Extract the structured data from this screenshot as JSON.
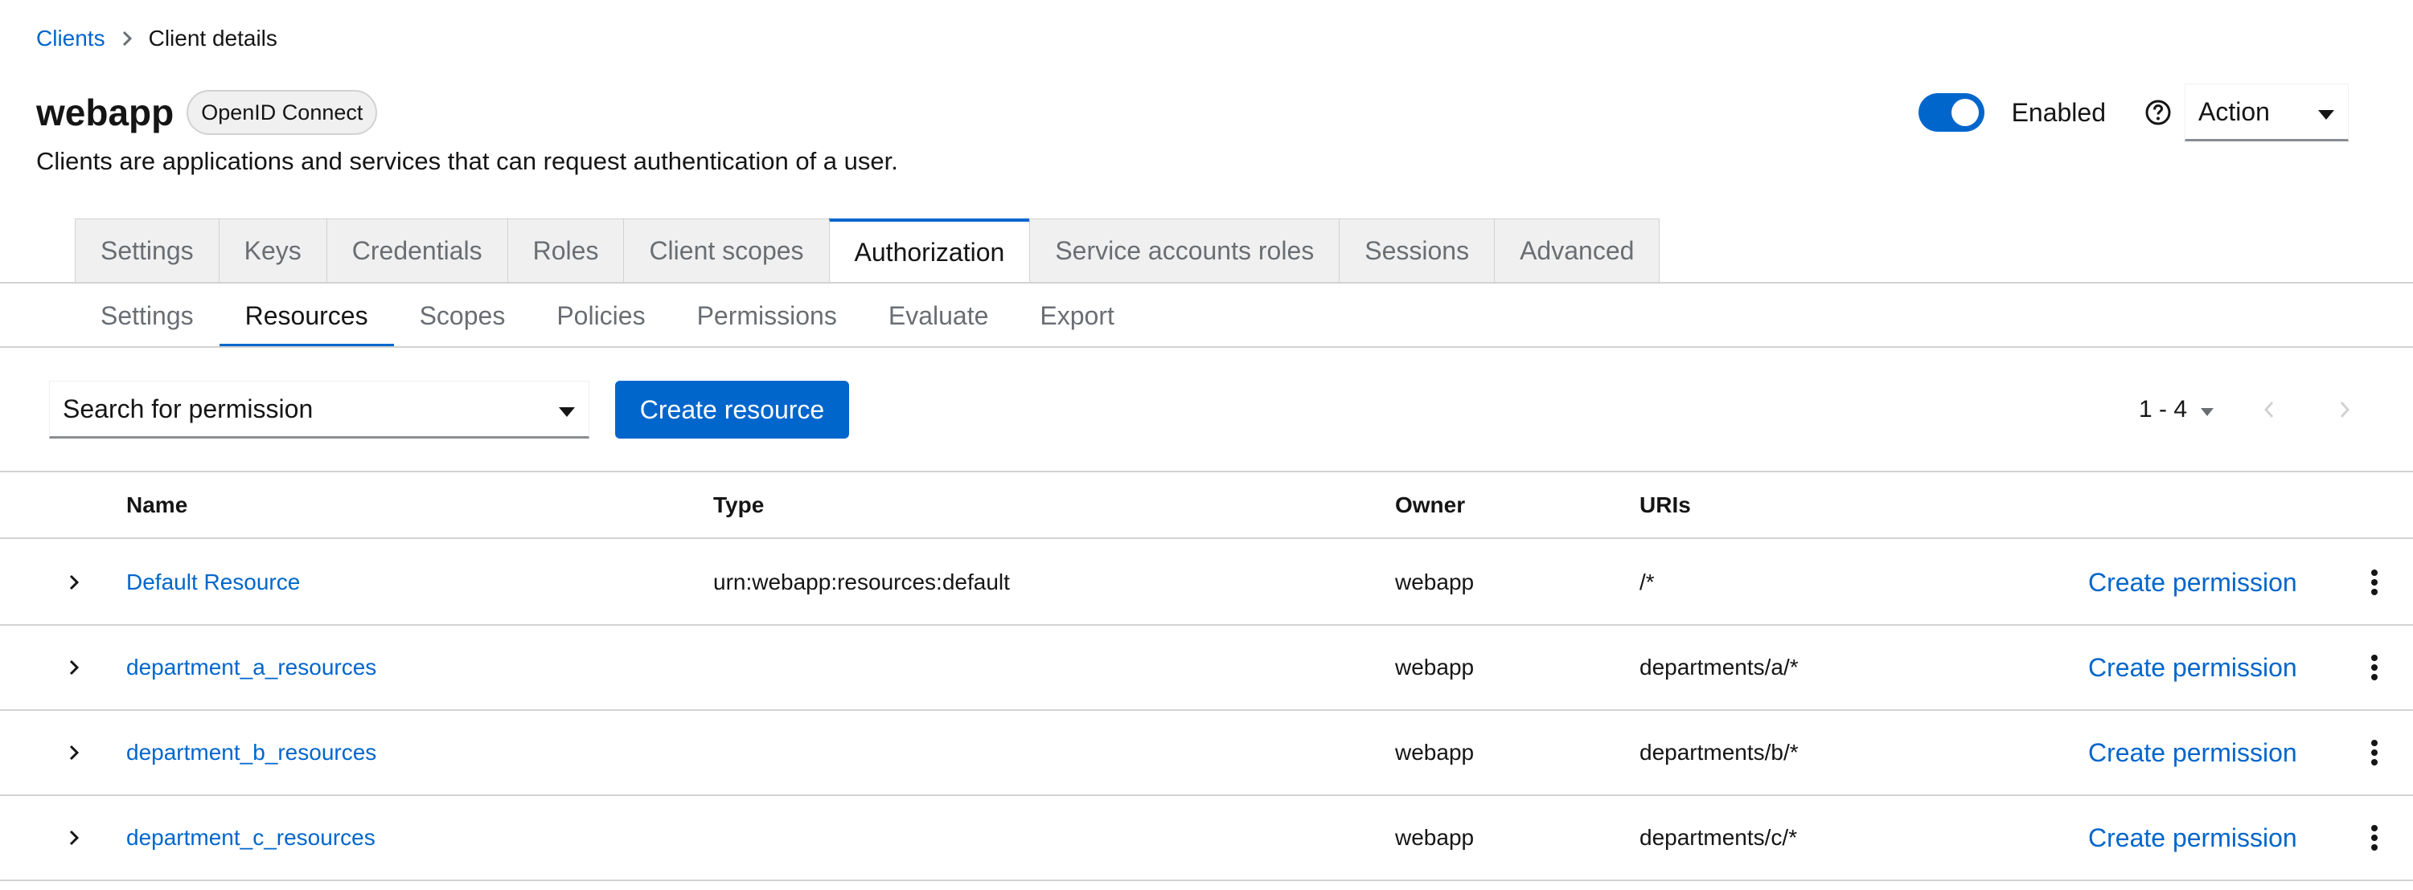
{
  "breadcrumb": {
    "root": "Clients",
    "current": "Client details"
  },
  "header": {
    "title": "webapp",
    "protocol_badge": "OpenID Connect",
    "description": "Clients are applications and services that can request authentication of a user.",
    "enabled_label": "Enabled",
    "enabled": true,
    "action_label": "Action"
  },
  "main_tabs": [
    {
      "label": "Settings"
    },
    {
      "label": "Keys"
    },
    {
      "label": "Credentials"
    },
    {
      "label": "Roles"
    },
    {
      "label": "Client scopes"
    },
    {
      "label": "Authorization",
      "active": true
    },
    {
      "label": "Service accounts roles"
    },
    {
      "label": "Sessions"
    },
    {
      "label": "Advanced"
    }
  ],
  "sub_tabs": [
    {
      "label": "Settings"
    },
    {
      "label": "Resources",
      "active": true
    },
    {
      "label": "Scopes"
    },
    {
      "label": "Policies"
    },
    {
      "label": "Permissions"
    },
    {
      "label": "Evaluate"
    },
    {
      "label": "Export"
    }
  ],
  "toolbar": {
    "search_label": "Search for permission",
    "create_label": "Create resource",
    "page_range": "1 - 4"
  },
  "table": {
    "headers": {
      "name": "Name",
      "type": "Type",
      "owner": "Owner",
      "uris": "URIs"
    },
    "rows": [
      {
        "name": "Default Resource",
        "type": "urn:webapp:resources:default",
        "owner": "webapp",
        "uris": "/*",
        "action": "Create permission"
      },
      {
        "name": "department_a_resources",
        "type": "",
        "owner": "webapp",
        "uris": "departments/a/*",
        "action": "Create permission"
      },
      {
        "name": "department_b_resources",
        "type": "",
        "owner": "webapp",
        "uris": "departments/b/*",
        "action": "Create permission"
      },
      {
        "name": "department_c_resources",
        "type": "",
        "owner": "webapp",
        "uris": "departments/c/*",
        "action": "Create permission"
      }
    ]
  },
  "colors": {
    "accent": "#0066cc",
    "border": "#d2d2d2",
    "muted": "#6a6e73",
    "tab_bg": "#f0f0f0"
  },
  "icons": {
    "breadcrumb_separator": "chevron-right-icon",
    "help": "question-circle-icon",
    "dropdown": "caret-down-icon",
    "expand": "chevron-right-icon",
    "row_menu": "kebab-icon",
    "prev_page": "chevron-left-icon",
    "next_page": "chevron-right-icon"
  }
}
